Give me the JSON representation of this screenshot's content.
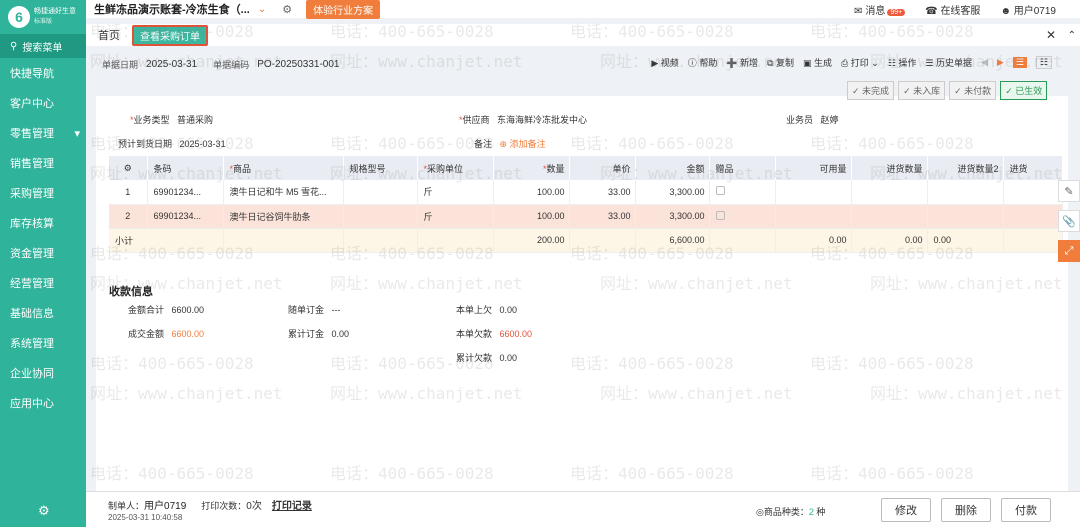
{
  "app": {
    "logo_text": "畅捷通好生意",
    "edition": "标准版",
    "account": "生鲜冻品演示账套-冷冻生食（...",
    "trial_button": "体验行业方案"
  },
  "top_right": {
    "messages": "消息",
    "messages_badge": "99+",
    "service": "在线客服",
    "user": "用户0719"
  },
  "sidebar": {
    "search": "搜索菜单",
    "items": [
      "快捷导航",
      "客户中心",
      "零售管理",
      "销售管理",
      "采购管理",
      "库存核算",
      "资金管理",
      "经营管理",
      "基础信息",
      "系统管理",
      "企业协同",
      "应用中心"
    ]
  },
  "tabs": {
    "home": "首页",
    "active": "查看采购订单"
  },
  "doc": {
    "date_label": "单据日期",
    "date": "2025-03-31",
    "code_label": "单据编码",
    "code": "PO-20250331-001"
  },
  "toolbar": [
    "视频",
    "帮助",
    "新增",
    "复制",
    "生成",
    "打印",
    "操作",
    "历史单据"
  ],
  "statuses": [
    "未完成",
    "未入库",
    "未付款",
    "已生效"
  ],
  "fields": {
    "biz_type_label": "业务类型",
    "biz_type": "普通采购",
    "supplier_label": "供应商",
    "supplier": "东海海鲜冷冻批发中心",
    "staff_label": "业务员",
    "staff": "赵婷",
    "arrival_label": "预计到货日期",
    "arrival": "2025-03-31",
    "remark_label": "备注",
    "add_remark": "添加备注"
  },
  "table": {
    "headers": [
      "条码",
      "商品",
      "规格型号",
      "采购单位",
      "数量",
      "单价",
      "金额",
      "赠品",
      "可用量",
      "进货数量",
      "进货数量2",
      "进货"
    ],
    "rows": [
      {
        "no": "1",
        "barcode": "69901234...",
        "product": "澳牛日记和牛 M5 雪花...",
        "spec": "",
        "unit": "斤",
        "qty": "100.00",
        "price": "33.00",
        "amount": "3,300.00"
      },
      {
        "no": "2",
        "barcode": "69901234...",
        "product": "澳牛日记谷饲牛肋条",
        "spec": "",
        "unit": "斤",
        "qty": "100.00",
        "price": "33.00",
        "amount": "3,300.00"
      }
    ],
    "subtotal": {
      "label": "小计",
      "qty": "200.00",
      "amount": "6,600.00",
      "avail": "0.00",
      "in_qty": "0.00",
      "in_qty2": "0.00"
    }
  },
  "payment": {
    "title": "收款信息",
    "total_label": "金额合计",
    "total": "6600.00",
    "deal_label": "成交金额",
    "deal": "6600.00",
    "deposit_label": "随单订金",
    "deposit": "---",
    "acc_deposit_label": "累计订金",
    "acc_deposit": "0.00",
    "prev_owe_label": "本单上欠",
    "prev_owe": "0.00",
    "owe_label": "本单欠款",
    "owe": "6600.00",
    "acc_owe_label": "累计欠款",
    "acc_owe": "0.00"
  },
  "footer": {
    "maker_label": "制单人：",
    "maker": "用户0719",
    "print_label": "打印次数：",
    "print_count": "0次",
    "print_log": "打印记录",
    "time": "2025-03-31 10:40:58",
    "kinds_label": "商品种类：",
    "kinds": "2",
    "kinds_unit": "种",
    "edit": "修改",
    "delete": "删除",
    "pay": "付款"
  },
  "watermark": {
    "phone": "电话：400-665-0028",
    "site": "网址：www.chanjet.net"
  },
  "colors": {
    "brand": "#2fb39a",
    "accent": "#f07d3c",
    "danger": "#e0533a"
  }
}
